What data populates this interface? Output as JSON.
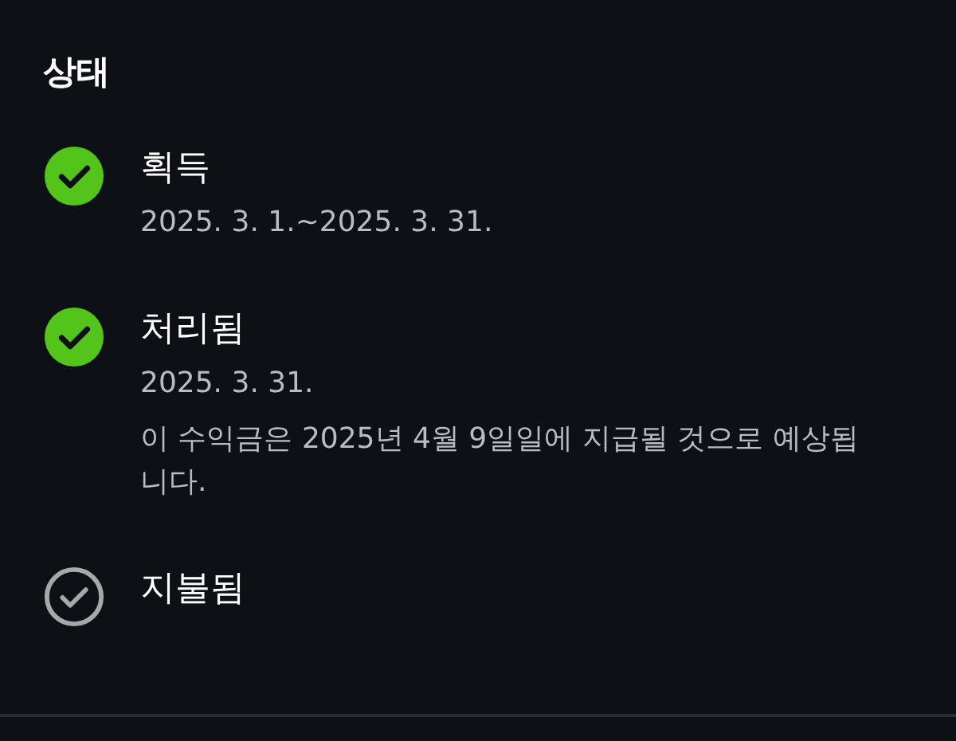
{
  "heading": "상태",
  "steps": [
    {
      "title": "획득",
      "done": true,
      "details": [
        "2025. 3. 1.~2025. 3. 31."
      ]
    },
    {
      "title": "처리됨",
      "done": true,
      "details": [
        "2025. 3. 31.",
        "이 수익금은 2025년 4월 9일일에 지급될 것으로 예상됩니다."
      ]
    },
    {
      "title": "지불됨",
      "done": false
    }
  ]
}
